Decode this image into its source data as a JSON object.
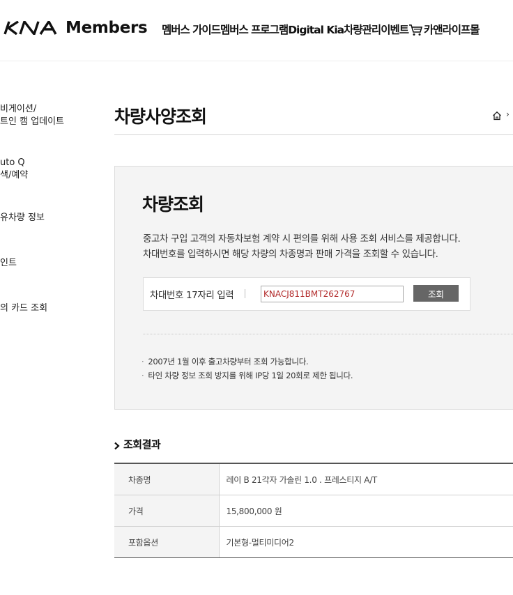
{
  "header": {
    "brand": "Members",
    "nav": [
      "멤버스 가이드",
      "멤버스 프로그램",
      "Digital Kia",
      "차량관리",
      "이벤트",
      "카앤라이프몰"
    ]
  },
  "sidebar": {
    "items": [
      {
        "lines": [
          "비게이션/",
          "트인 캠 업데이트"
        ]
      },
      {
        "lines": [
          "uto Q",
          "색/예약"
        ]
      },
      {
        "lines": [
          "유차량 정보"
        ]
      },
      {
        "lines": [
          "인트"
        ]
      },
      {
        "lines": [
          "의 카드 조회"
        ]
      }
    ]
  },
  "page": {
    "title": "차량사양조회",
    "breadcrumb_sep": "›"
  },
  "panel": {
    "title": "차량조회",
    "desc": [
      "중고차 구입 고객의 자동차보험 계약 시 편의를 위해 사용 조회 서비스를 제공합니다.",
      "차대번호를 입력하시면 해당 차량의 차종명과 판매 가격을 조회할 수 있습니다."
    ],
    "vin_label": "차대번호 17자리 입력",
    "vin_value": "KNACJ811BMT262767",
    "search_button": "조회",
    "bullet": "·",
    "notes": [
      "2007년 1월 이후 출고차량부터 조회 가능합니다.",
      "타인 차량 정보 조회 방지를 위해 IP당 1일 20회로 제한 됩니다."
    ]
  },
  "result": {
    "title": "조회결과",
    "rows": [
      {
        "label": "차종명",
        "value": "레이 B 21각자 가솔린 1.0 . 프레스티지 A/T"
      },
      {
        "label": "가격",
        "value": "15,800,000 원"
      },
      {
        "label": "포함옵션",
        "value": "기본형-멀티미디어2"
      }
    ]
  },
  "icons": {
    "logo": "kia-logo",
    "cart": "cart-icon",
    "home": "home-icon",
    "chevron": "chevron-right-icon"
  }
}
